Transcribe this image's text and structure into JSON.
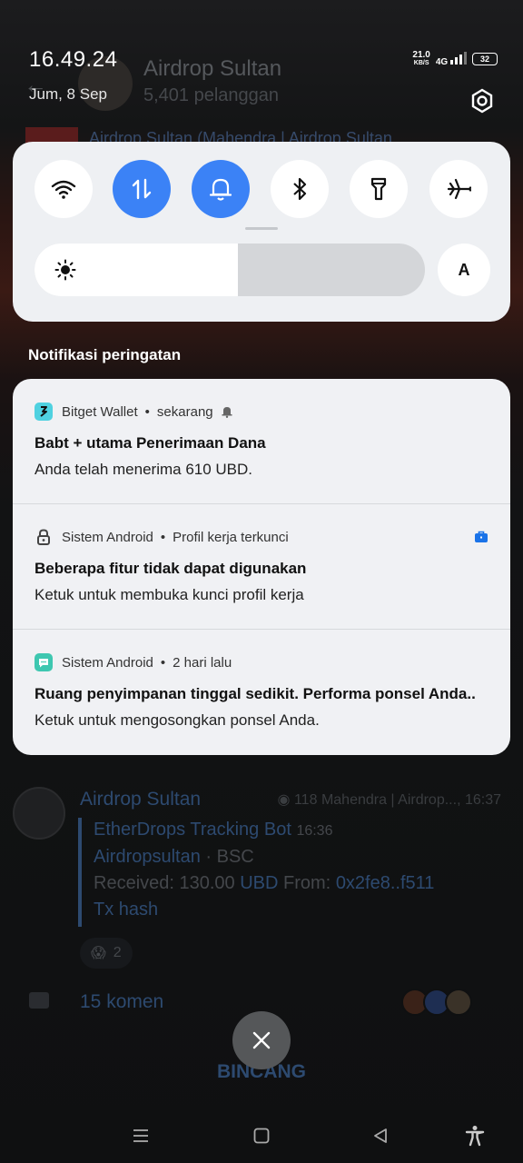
{
  "status_bar": {
    "time": "16.49.24",
    "date": "Jum, 8 Sep",
    "net_speed_value": "21.0",
    "net_speed_unit": "KB/S",
    "signal_label": "4G",
    "battery": "32"
  },
  "background_app": {
    "channel_title": "Airdrop Sultan",
    "channel_subtitle": "5,401 pelanggan",
    "pinned_text": "Airdrop Sultan (Mahendra | Airdrop Sultan",
    "post": {
      "author": "Airdrop Sultan",
      "views": "118",
      "meta": "Mahendra | Airdrop..., 16:37",
      "bot_name": "EtherDrops Tracking Bot",
      "bot_time": "16:36",
      "line1_a": "Airdropsultan",
      "line1_b": " · BSC",
      "line2_label": "Received: 130.00 ",
      "line2_token": "UBD",
      "line2_from": " From: ",
      "line2_addr": "0x2fe8..f511",
      "line3": "Tx hash",
      "reaction_count": "2",
      "comments": "15 komen"
    },
    "bottom_button": "BINCANG"
  },
  "quick_settings": {
    "tiles": [
      {
        "name": "wifi",
        "on": false
      },
      {
        "name": "mobile-data",
        "on": true
      },
      {
        "name": "sound",
        "on": true
      },
      {
        "name": "bluetooth",
        "on": false
      },
      {
        "name": "flashlight",
        "on": false
      },
      {
        "name": "airplane-mode",
        "on": false
      }
    ],
    "brightness_fraction": 0.52,
    "auto_label": "A",
    "accent_color": "#3b82f6"
  },
  "notifications_section_title": "Notifikasi peringatan",
  "notifications": [
    {
      "app": "Bitget Wallet",
      "time": "sekarang",
      "title": "Babt + utama Penerimaan Dana",
      "body": "Anda telah menerima 610 UBD."
    },
    {
      "app": "Sistem Android",
      "time": "Profil kerja terkunci",
      "title": "Beberapa fitur tidak dapat digunakan",
      "body": "Ketuk untuk membuka kunci profil kerja"
    },
    {
      "app": "Sistem Android",
      "time": "2 hari lalu",
      "title": "Ruang penyimpanan tinggal sedikit. Performa ponsel Anda..",
      "body": "Ketuk untuk mengosongkan ponsel Anda."
    }
  ]
}
